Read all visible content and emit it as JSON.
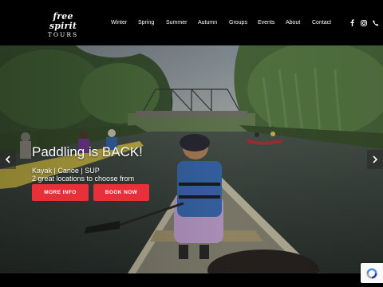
{
  "header": {
    "logo": {
      "line1": "free spirit",
      "line2": "TOURS"
    },
    "nav": [
      "Winter",
      "Spring",
      "Summer",
      "Autumn",
      "Groups",
      "Events",
      "About",
      "Contact"
    ],
    "social_icons": [
      "facebook-icon",
      "instagram-icon",
      "phone-icon"
    ]
  },
  "hero": {
    "headline": "Paddling is BACK!",
    "subline1": "Kayak | Canoe | SUP",
    "subline2": "2 great locations to choose from",
    "buttons": {
      "more_info": "MORE INFO",
      "book_now": "BOOK NOW"
    },
    "arrows": [
      "chevron-left-icon",
      "chevron-right-icon"
    ]
  },
  "colors": {
    "accent": "#e8303a",
    "header_bg": "#000000",
    "text": "#ffffff"
  },
  "widgets": {
    "recaptcha": "recaptcha-icon"
  }
}
